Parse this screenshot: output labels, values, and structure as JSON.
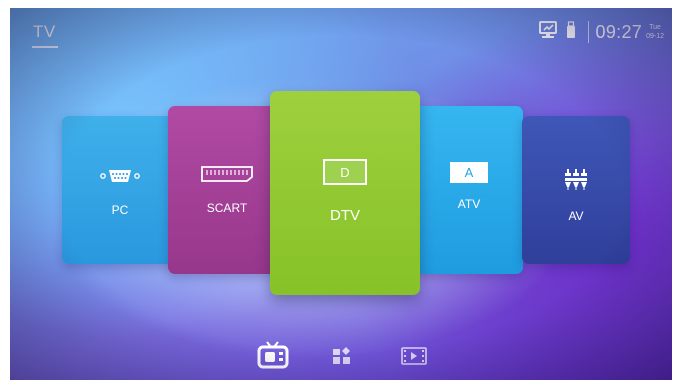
{
  "header": {
    "title": "TV"
  },
  "status": {
    "time": "09:27",
    "day": "Tue",
    "date": "09-12",
    "icons": [
      "network-icon",
      "usb-icon"
    ]
  },
  "sources": [
    {
      "label": "PC",
      "icon": "vga-port-icon",
      "color": "#2fa4e6"
    },
    {
      "label": "SCART",
      "icon": "scart-port-icon",
      "color": "#a03f94"
    },
    {
      "label": "DTV",
      "icon": "dtv-icon",
      "glyph": "D",
      "color": "#8fc831",
      "selected": true
    },
    {
      "label": "ATV",
      "icon": "atv-icon",
      "glyph": "A",
      "color": "#27a6ea"
    },
    {
      "label": "AV",
      "icon": "av-connector-icon",
      "color": "#354aa8"
    }
  ],
  "bottom_nav": [
    {
      "name": "tv",
      "icon": "tv-icon",
      "active": true
    },
    {
      "name": "apps",
      "icon": "apps-icon",
      "active": false
    },
    {
      "name": "media",
      "icon": "media-icon",
      "active": false
    }
  ]
}
